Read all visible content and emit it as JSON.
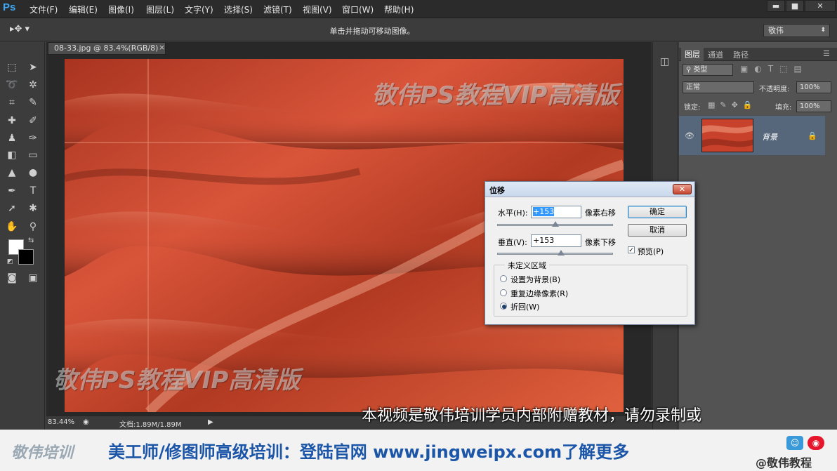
{
  "app": {
    "logo": "Ps"
  },
  "menu": [
    "文件(F)",
    "编辑(E)",
    "图像(I)",
    "图层(L)",
    "文字(Y)",
    "选择(S)",
    "滤镜(T)",
    "视图(V)",
    "窗口(W)",
    "帮助(H)"
  ],
  "window_buttons": {
    "minimize": "▬",
    "maximize": "■",
    "close": "✕"
  },
  "options_bar": {
    "hint": "单击并拖动可移动图像。",
    "workspace": "敬伟"
  },
  "document": {
    "tab_title": "08-33.jpg @ 83.4%(RGB/8)",
    "tab_close": "×",
    "zoom": "83.44%",
    "doc_info": "文档:1.89M/1.89M"
  },
  "layers_panel": {
    "tabs": [
      "图层",
      "通道",
      "路径"
    ],
    "filter_kind": "类型",
    "blend_mode": "正常",
    "opacity_label": "不透明度:",
    "opacity_value": "100%",
    "lock_label": "锁定:",
    "fill_label": "填充:",
    "fill_value": "100%",
    "layer_name": "背景"
  },
  "dialog": {
    "title": "位移",
    "close": "✕",
    "horizontal_label": "水平(H):",
    "horizontal_value": "+153",
    "horizontal_unit": "像素右移",
    "horizontal_slider": 0.5,
    "vertical_label": "垂直(V):",
    "vertical_value": "+153",
    "vertical_unit": "像素下移",
    "vertical_slider": 0.55,
    "ok": "确定",
    "cancel": "取消",
    "preview_label": "预览(P)",
    "preview_checked": true,
    "region_title": "未定义区域",
    "options": [
      {
        "label": "设置为背景(B)",
        "selected": false
      },
      {
        "label": "重复边缘像素(R)",
        "selected": false
      },
      {
        "label": "折回(W)",
        "selected": true
      }
    ]
  },
  "watermarks": [
    "敬伟PS教程VIP高清版",
    "敬伟PS教程VIP高清版"
  ],
  "subtitle": "本视频是敬伟培训学员内部附赠教材，请勿录制或",
  "banner": {
    "logo": "敬伟培训",
    "text": "美工师/修图师高级培训：登陆官网 www.jingweipx.com了解更多",
    "weibo": "@敬伟教程"
  },
  "colors": {
    "accent": "#3da8f5",
    "banner_text": "#1b55a8",
    "selected_layer": "#56677c",
    "leather": "#c8412a"
  }
}
